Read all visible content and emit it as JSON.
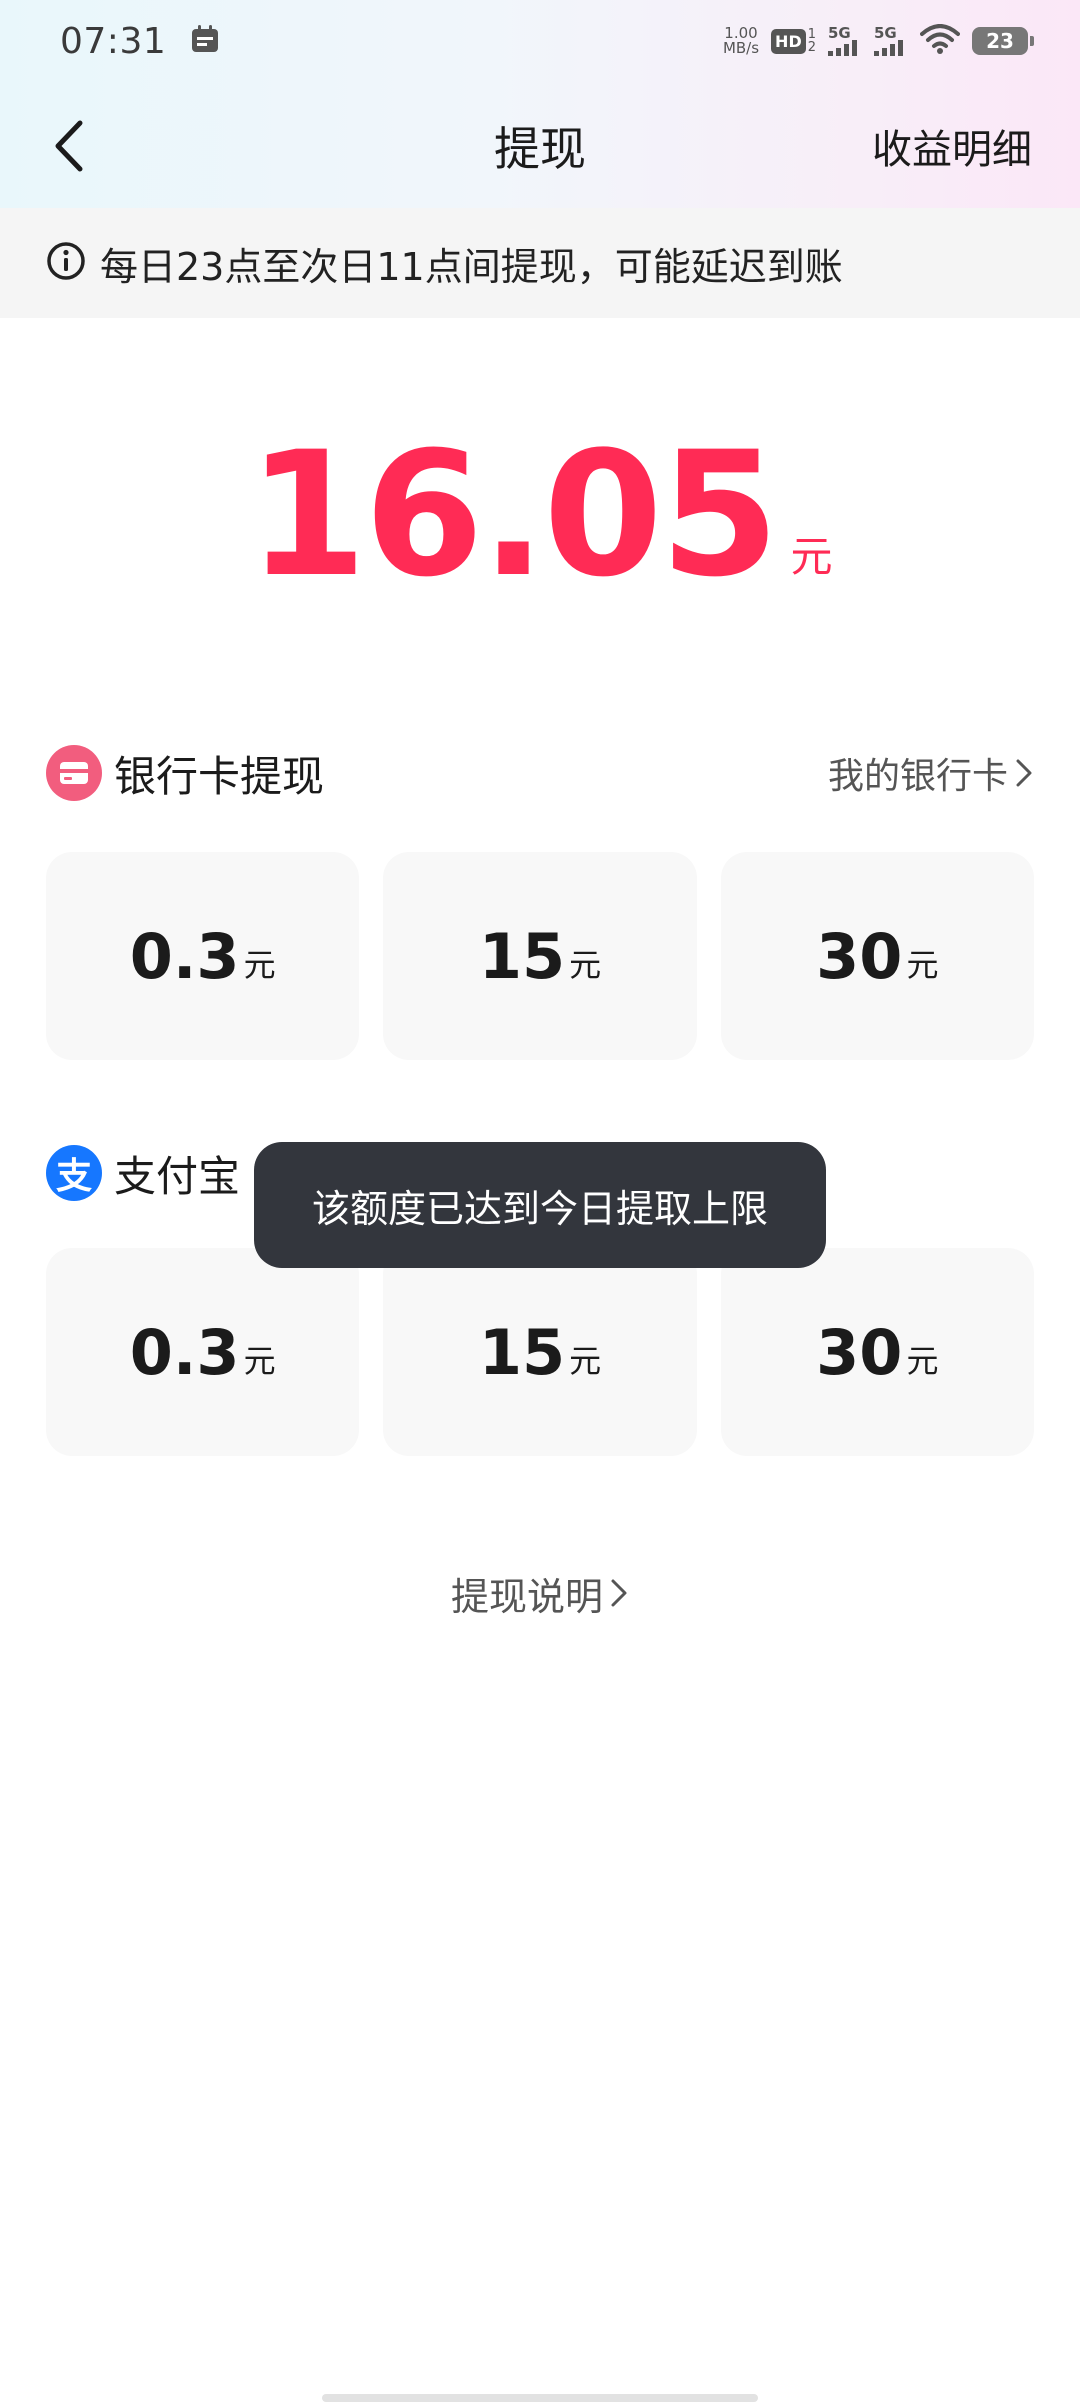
{
  "status_bar": {
    "time": "07:31",
    "net_speed_value": "1.00",
    "net_speed_unit": "MB/s",
    "hd_label": "HD",
    "hd_sub_top": "1",
    "hd_sub_bottom": "2",
    "signal1_label": "5G",
    "signal2_label": "5G",
    "battery": "23",
    "icons": [
      "calendar-icon",
      "wifi-icon",
      "battery-icon"
    ]
  },
  "nav": {
    "title": "提现",
    "right_action": "收益明细"
  },
  "notice": {
    "text": "每日23点至次日11点间提现，可能延迟到账"
  },
  "balance": {
    "amount": "16.05",
    "unit": "元",
    "color": "#ff2b55"
  },
  "bank_section": {
    "title": "银行卡提现",
    "link": "我的银行卡",
    "icon_color": "#f25d7e",
    "options": [
      {
        "value": "0.3",
        "unit": "元"
      },
      {
        "value": "15",
        "unit": "元"
      },
      {
        "value": "30",
        "unit": "元"
      }
    ]
  },
  "alipay_section": {
    "title": "支付宝",
    "icon_glyph": "支",
    "icon_color": "#1677ff",
    "options": [
      {
        "value": "0.3",
        "unit": "元"
      },
      {
        "value": "15",
        "unit": "元"
      },
      {
        "value": "30",
        "unit": "元"
      }
    ]
  },
  "toast": {
    "text": "该额度已达到今日提取上限"
  },
  "explain_link": {
    "text": "提现说明"
  }
}
